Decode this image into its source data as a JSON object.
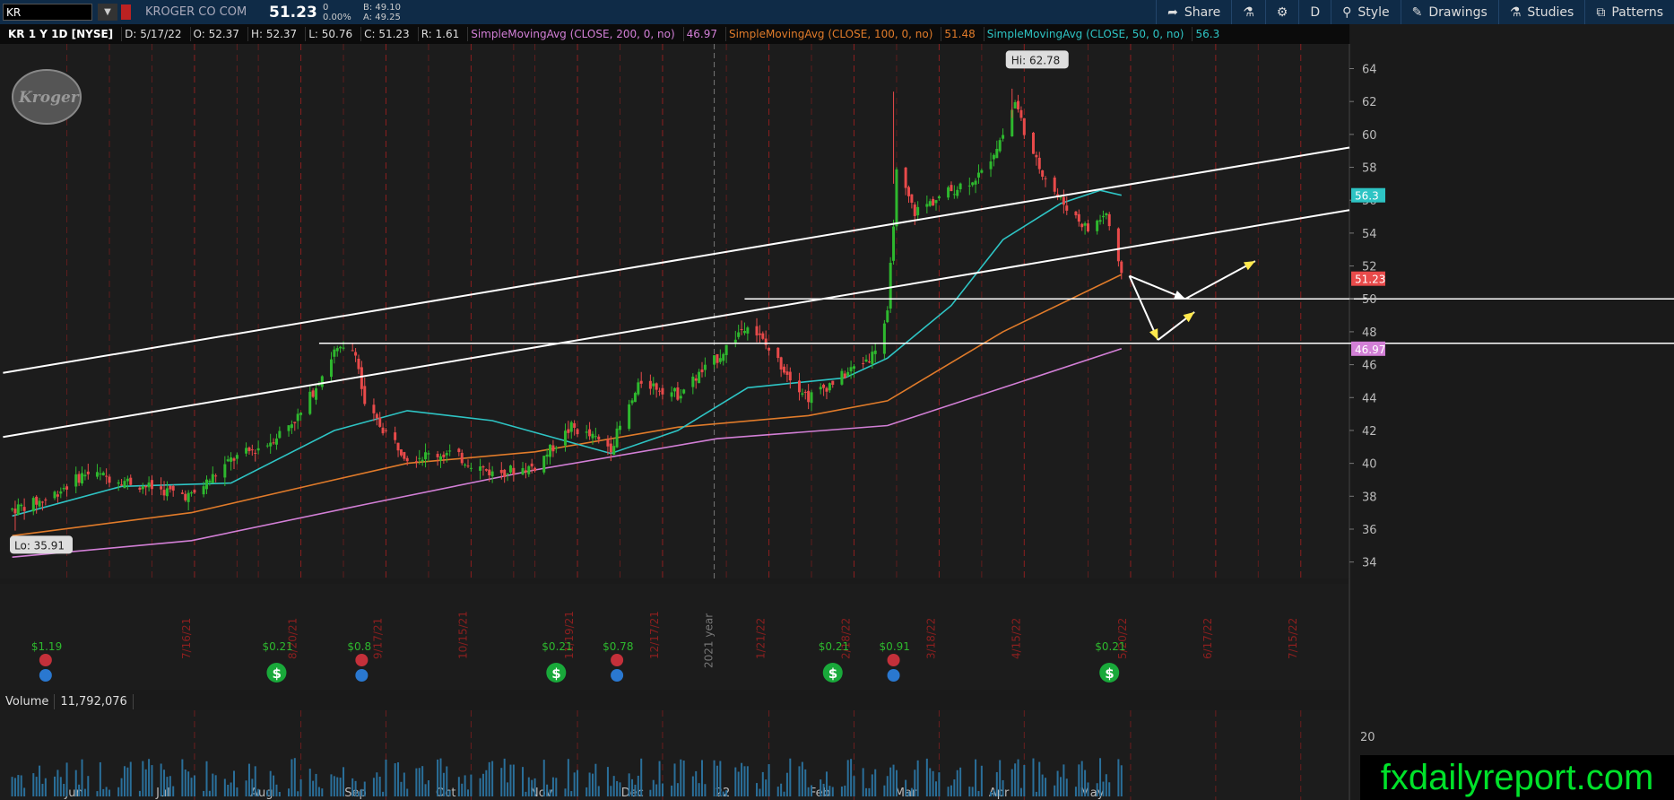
{
  "toolbar": {
    "symbol": "KR",
    "company": "KROGER CO COM",
    "last": "51.23",
    "change": "0",
    "change_pct": "0.00%",
    "bid": "B: 49.10",
    "ask": "A: 49.25",
    "share": "Share",
    "period": "D",
    "style": "Style",
    "drawings": "Drawings",
    "studies": "Studies",
    "patterns": "Patterns"
  },
  "infobar": {
    "title": "KR 1 Y 1D [NYSE]",
    "date": "D: 5/17/22",
    "open": "O: 52.37",
    "high": "H: 52.37",
    "low": "L: 50.76",
    "close": "C: 51.23",
    "range": "R: 1.61",
    "sma200_label": "SimpleMovingAvg (CLOSE, 200, 0, no)",
    "sma200_val": "46.97",
    "sma100_label": "SimpleMovingAvg (CLOSE, 100, 0, no)",
    "sma100_val": "51.48",
    "sma50_label": "SimpleMovingAvg (CLOSE, 50, 0, no)",
    "sma50_val": "56.3"
  },
  "colors": {
    "up": "#2eb82e",
    "down": "#e84a4a",
    "sma200": "#d27fd6",
    "sma100": "#e07b2a",
    "sma50": "#2ec4c4",
    "grid": "#8b1f1f",
    "brand": "#00e22a"
  },
  "chart_data": {
    "type": "candlestick",
    "title": "KR 1 Y 1D [NYSE]",
    "ylim": [
      33,
      65.5
    ],
    "y_ticks": [
      34,
      36,
      38,
      40,
      42,
      44,
      46,
      48,
      50,
      52,
      54,
      56,
      58,
      60,
      62,
      64
    ],
    "x_month_labels": [
      "Jun",
      "Jul",
      "Aug",
      "Sep",
      "Oct",
      "Nov",
      "Dec",
      "22",
      "Feb",
      "Mar",
      "Apr",
      "May"
    ],
    "x_date_markers": [
      "7/16/21",
      "8/20/21",
      "9/17/21",
      "10/15/21",
      "11/19/21",
      "12/17/21",
      "1/21/22",
      "2/18/22",
      "3/18/22",
      "4/15/22",
      "5/20/22",
      "6/17/22",
      "7/15/22"
    ],
    "year_marker": "2021 year",
    "price_path": [
      [
        "2021-05-17",
        37.2
      ],
      [
        "2021-05-28",
        37.8
      ],
      [
        "2021-06-10",
        39.4
      ],
      [
        "2021-06-22",
        39.0
      ],
      [
        "2021-07-02",
        38.5
      ],
      [
        "2021-07-15",
        38.0
      ],
      [
        "2021-07-28",
        40.2
      ],
      [
        "2021-08-09",
        41.2
      ],
      [
        "2021-08-20",
        43.0
      ],
      [
        "2021-08-31",
        46.8
      ],
      [
        "2021-09-07",
        46.9
      ],
      [
        "2021-09-10",
        43.4
      ],
      [
        "2021-09-24",
        40.4
      ],
      [
        "2021-10-08",
        40.6
      ],
      [
        "2021-10-22",
        39.4
      ],
      [
        "2021-11-05",
        39.8
      ],
      [
        "2021-11-17",
        42.2
      ],
      [
        "2021-11-30",
        41.0
      ],
      [
        "2021-12-10",
        45.0
      ],
      [
        "2021-12-22",
        44.2
      ],
      [
        "2022-01-04",
        46.4
      ],
      [
        "2022-01-14",
        48.6
      ],
      [
        "2022-01-24",
        46.2
      ],
      [
        "2022-02-03",
        44.0
      ],
      [
        "2022-02-15",
        45.4
      ],
      [
        "2022-02-24",
        46.6
      ],
      [
        "2022-03-01",
        49.0
      ],
      [
        "2022-03-04",
        57.6
      ],
      [
        "2022-03-10",
        55.3
      ],
      [
        "2022-03-22",
        56.6
      ],
      [
        "2022-04-01",
        57.6
      ],
      [
        "2022-04-08",
        60.0
      ],
      [
        "2022-04-12",
        62.0
      ],
      [
        "2022-04-18",
        58.6
      ],
      [
        "2022-04-27",
        56.0
      ],
      [
        "2022-05-06",
        54.2
      ],
      [
        "2022-05-12",
        55.2
      ],
      [
        "2022-05-17",
        51.23
      ]
    ],
    "hi_label": "Hi: 62.78",
    "lo_label": "Lo: 35.91",
    "sma200": [
      [
        "2021-05-17",
        34.3
      ],
      [
        "2021-07-15",
        35.3
      ],
      [
        "2021-09-10",
        37.5
      ],
      [
        "2021-11-05",
        39.6
      ],
      [
        "2022-01-04",
        41.5
      ],
      [
        "2022-03-01",
        42.3
      ],
      [
        "2022-04-08",
        44.6
      ],
      [
        "2022-05-17",
        46.97
      ]
    ],
    "sma100": [
      [
        "2021-05-17",
        35.6
      ],
      [
        "2021-07-15",
        37.0
      ],
      [
        "2021-08-31",
        39.0
      ],
      [
        "2021-09-24",
        40.0
      ],
      [
        "2021-11-05",
        40.7
      ],
      [
        "2021-12-22",
        42.2
      ],
      [
        "2022-02-03",
        42.9
      ],
      [
        "2022-03-01",
        43.8
      ],
      [
        "2022-04-08",
        48.0
      ],
      [
        "2022-05-17",
        51.48
      ]
    ],
    "sma50": [
      [
        "2021-05-17",
        36.8
      ],
      [
        "2021-06-22",
        38.6
      ],
      [
        "2021-07-28",
        38.8
      ],
      [
        "2021-08-31",
        42.0
      ],
      [
        "2021-09-24",
        43.2
      ],
      [
        "2021-10-22",
        42.6
      ],
      [
        "2021-11-30",
        40.6
      ],
      [
        "2021-12-22",
        42.0
      ],
      [
        "2022-01-14",
        44.6
      ],
      [
        "2022-02-15",
        45.2
      ],
      [
        "2022-03-01",
        46.4
      ],
      [
        "2022-03-22",
        49.6
      ],
      [
        "2022-04-08",
        53.6
      ],
      [
        "2022-04-27",
        55.8
      ],
      [
        "2022-05-10",
        56.6
      ],
      [
        "2022-05-17",
        56.3
      ]
    ],
    "trendlines": [
      {
        "x1": "2021-05-14",
        "y1": 45.5,
        "x2": "2022-07-31",
        "y2": 59.2
      },
      {
        "x1": "2021-05-14",
        "y1": 41.6,
        "x2": "2022-07-31",
        "y2": 55.4
      }
    ],
    "h_lines": [
      {
        "from": "2022-01-13",
        "value": 50.0
      },
      {
        "from": "2021-08-26",
        "value": 47.3
      }
    ],
    "dividends": [
      {
        "date": "2021-05-28",
        "label": "$1.19",
        "color": "green",
        "type": "split"
      },
      {
        "date": "2021-08-12",
        "label": "$0.21",
        "color": "green",
        "type": "dividend"
      },
      {
        "date": "2021-09-09",
        "label": "$0.8",
        "color": "green",
        "type": "earnings"
      },
      {
        "date": "2021-11-12",
        "label": "$0.21",
        "color": "green",
        "type": "dividend"
      },
      {
        "date": "2021-12-02",
        "label": "$0.78",
        "color": "green",
        "type": "earnings"
      },
      {
        "date": "2022-02-11",
        "label": "$0.21",
        "color": "green",
        "type": "dividend"
      },
      {
        "date": "2022-03-03",
        "label": "$0.91",
        "color": "green",
        "type": "earnings"
      },
      {
        "date": "2022-05-13",
        "label": "$0.21",
        "color": "green",
        "type": "dividend"
      }
    ],
    "price_tags": [
      {
        "value": 56.3,
        "label": "56.3",
        "color": "#2ec4c4"
      },
      {
        "value": 51.23,
        "label": "51.23",
        "color": "#e84a4a"
      },
      {
        "value": 46.97,
        "label": "46.97",
        "color": "#d27fd6"
      }
    ],
    "volume": {
      "label": "Volume",
      "value": "11,792,076",
      "axis_tick": "20"
    }
  },
  "brand": "fxdailyreport.com"
}
